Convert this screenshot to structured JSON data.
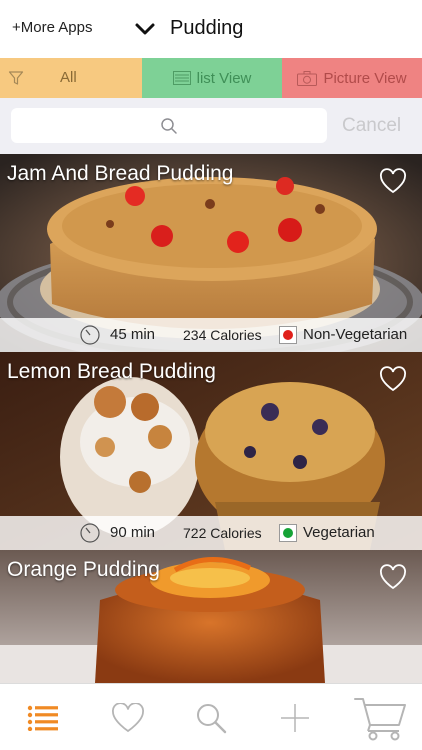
{
  "header": {
    "more_apps": "+More Apps",
    "title": "Pudding"
  },
  "filters": {
    "all": "All",
    "list_view": "list View",
    "picture_view": "Picture View",
    "colors": {
      "all": "#f7c980",
      "list": "#7ed196",
      "picture": "#ef8382"
    }
  },
  "search": {
    "placeholder": "",
    "cancel": "Cancel"
  },
  "recipes": [
    {
      "name": "Jam And Bread Pudding",
      "time": "45 min",
      "calories": "234 Calories",
      "type": "Non-Vegetarian",
      "type_color": "#e0201b",
      "favorite": false
    },
    {
      "name": "Lemon Bread Pudding",
      "time": "90 min",
      "calories": "722 Calories",
      "type": "Vegetarian",
      "type_color": "#15a336",
      "favorite": false
    },
    {
      "name": "Orange Pudding",
      "favorite": false
    }
  ],
  "tabbar": {
    "items": [
      {
        "icon": "list-icon",
        "active": true
      },
      {
        "icon": "heart-icon",
        "active": false
      },
      {
        "icon": "search-icon",
        "active": false
      },
      {
        "icon": "plus-icon",
        "active": false
      },
      {
        "icon": "cart-icon",
        "active": false
      }
    ],
    "active_color": "#f08a24"
  }
}
